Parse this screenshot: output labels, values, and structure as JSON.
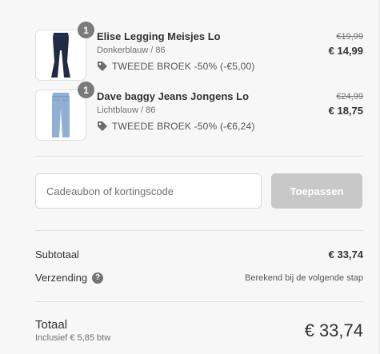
{
  "items": [
    {
      "quantity": "1",
      "name": "Elise Legging Meisjes Lo",
      "variant": "Donkerblauw / 86",
      "discount": "TWEEDE BROEK -50% (-€5,00)",
      "old_price": "€19,99",
      "new_price": "€ 14,99",
      "image_icon": "dark-navy-flared-legging",
      "garment_color": "#1f2a44"
    },
    {
      "quantity": "1",
      "name": "Dave baggy Jeans Jongens Lo",
      "variant": "Lichtblauw / 86",
      "discount": "TWEEDE BROEK -50% (-€6,24)",
      "old_price": "€24,99",
      "new_price": "€ 18,75",
      "image_icon": "light-blue-baggy-jeans",
      "garment_color": "#8fb0d3"
    }
  ],
  "discount_code": {
    "placeholder": "Cadeaubon of kortingscode",
    "apply_label": "Toepassen"
  },
  "summary": {
    "subtotal_label": "Subtotaal",
    "subtotal_value": "€ 33,74",
    "shipping_label": "Verzending",
    "shipping_help": "?",
    "shipping_value": "Berekend bij de volgende stap",
    "total_label": "Totaal",
    "tax_note": "Inclusief € 5,85 btw",
    "total_value": "€ 33,74"
  },
  "colors": {
    "background": "#f7f7f7",
    "apply_disabled": "#c8c8c8",
    "badge": "#7a7a7a"
  }
}
